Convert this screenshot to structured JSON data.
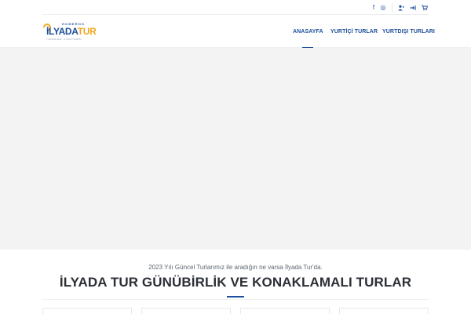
{
  "topbar": {
    "icons": [
      "facebook-icon",
      "instagram-icon",
      "user-add-icon",
      "login-icon",
      "cart-icon"
    ],
    "glyphs": {
      "facebook": "f",
      "instagram": "◎",
      "user_add": "👤",
      "login": "➜",
      "cart": "🛒"
    }
  },
  "logo": {
    "top": "HOMEROS",
    "main_a": "İLYADA",
    "main_b": "TUR",
    "sub": "TÜRSAB 8442 · İLYADA TURİZM"
  },
  "nav": {
    "items": [
      {
        "label": "ANASAYFA",
        "active": true
      },
      {
        "label": "YURTİÇİ TURLAR",
        "active": false
      },
      {
        "label": "YURTDIŞI TURLARI",
        "active": false
      }
    ]
  },
  "intro": {
    "subtitle": "2023 Yılı Güncel Turlarımız ile aradığın ne varsa İlyada Tur'da.",
    "title": "İLYADA TUR GÜNÜBİRLİK VE KONAKLAMALI TURLAR"
  },
  "colors": {
    "accent": "#1e4f9c",
    "brand_orange": "#f2a81d",
    "hero_bg": "#f3f3f3",
    "title_text": "#2b2f36"
  }
}
